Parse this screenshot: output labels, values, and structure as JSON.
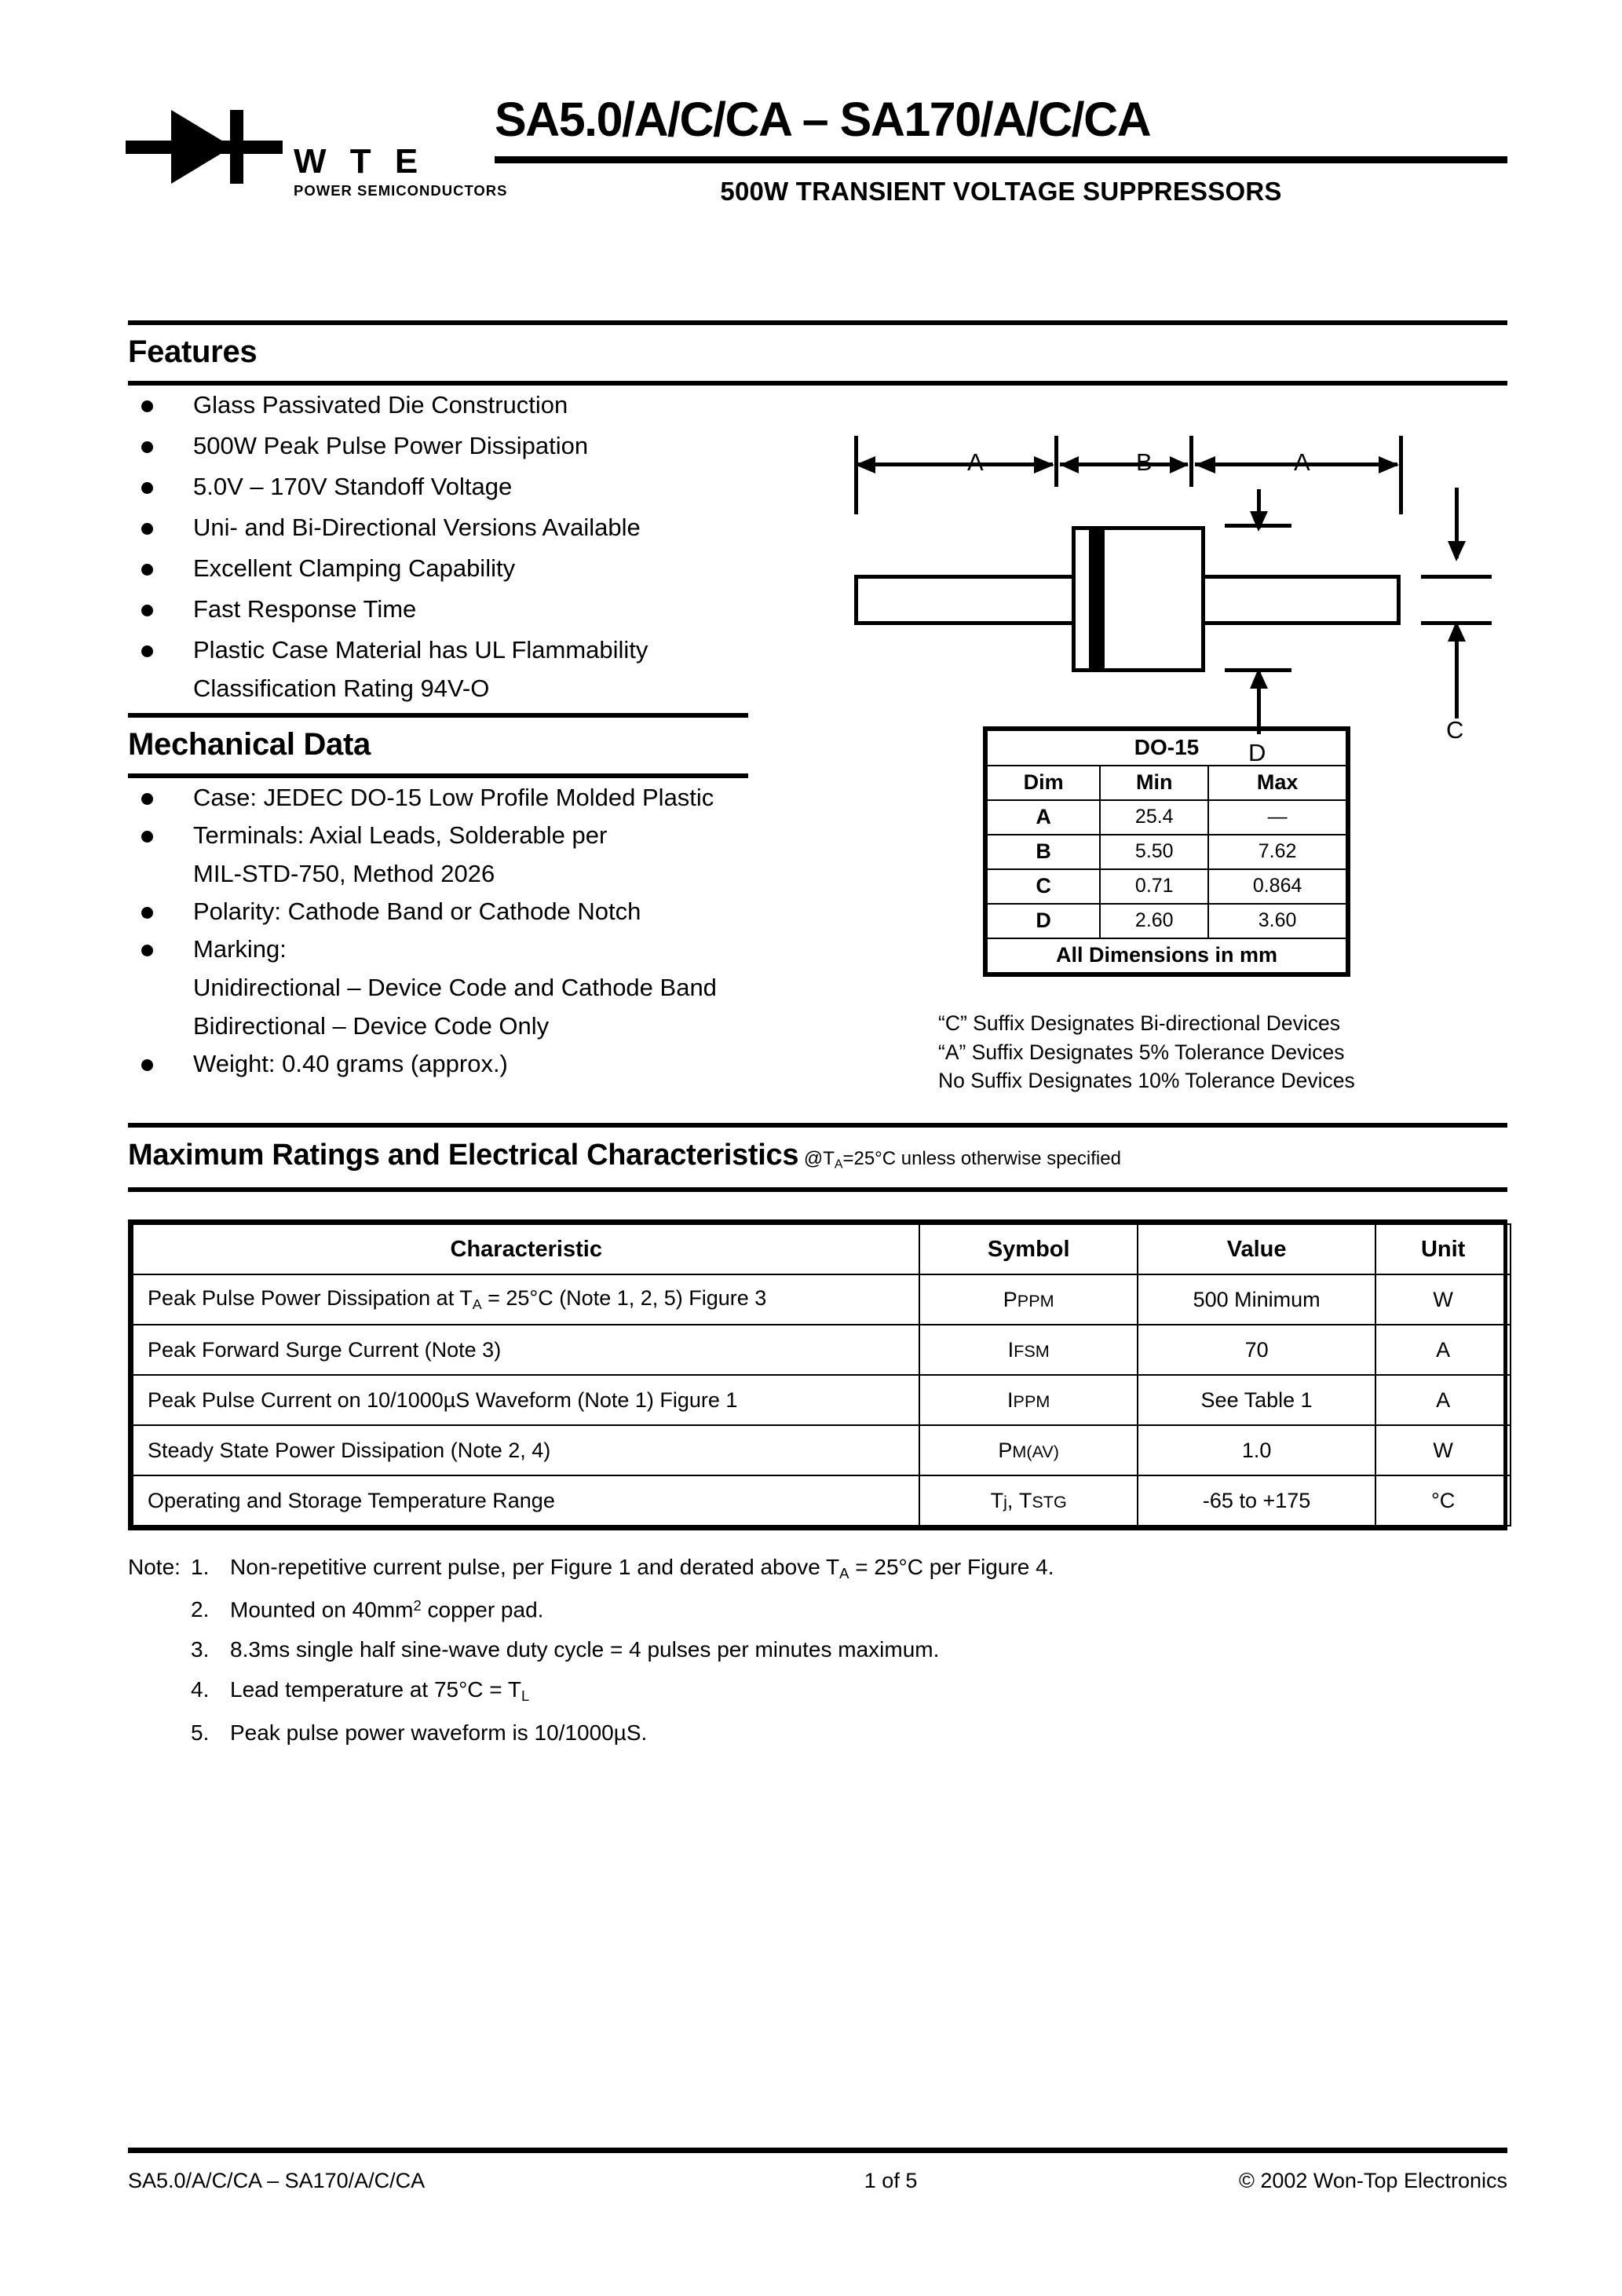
{
  "header": {
    "logo": {
      "brand": "W T E",
      "tagline": "POWER SEMICONDUCTORS"
    },
    "title": "SA5.0/A/C/CA – SA170/A/C/CA",
    "subtitle": "500W TRANSIENT VOLTAGE SUPPRESSORS"
  },
  "features": {
    "heading": "Features",
    "items": [
      "Glass Passivated Die Construction",
      "500W Peak Pulse Power Dissipation",
      "5.0V – 170V Standoff Voltage",
      "Uni- and Bi-Directional Versions Available",
      "Excellent Clamping Capability",
      "Fast Response Time",
      "Plastic Case Material has UL Flammability"
    ],
    "item7_cont": "Classification Rating 94V-O"
  },
  "mechanical": {
    "heading": "Mechanical Data",
    "items": [
      "Case: JEDEC DO-15 Low Profile Molded Plastic",
      "Terminals: Axial Leads, Solderable per",
      "Polarity: Cathode Band or Cathode Notch",
      "Marking:",
      "Weight: 0.40 grams (approx.)"
    ],
    "item2_cont": "MIL-STD-750, Method 2026",
    "marking_line1": "Unidirectional – Device Code and Cathode Band",
    "marking_line2": "Bidirectional – Device Code Only"
  },
  "package_drawing": {
    "label_a_left": "A",
    "label_b": "B",
    "label_a_right": "A",
    "label_c": "C",
    "label_d": "D"
  },
  "dim_table": {
    "title": "DO-15",
    "headers": [
      "Dim",
      "Min",
      "Max"
    ],
    "rows": [
      [
        "A",
        "25.4",
        "—"
      ],
      [
        "B",
        "5.50",
        "7.62"
      ],
      [
        "C",
        "0.71",
        "0.864"
      ],
      [
        "D",
        "2.60",
        "3.60"
      ]
    ],
    "footer": "All Dimensions in mm"
  },
  "suffix_notes": [
    "“C” Suffix Designates Bi-directional Devices",
    "“A” Suffix Designates 5% Tolerance Devices",
    "No Suffix Designates 10% Tolerance Devices"
  ],
  "max_ratings": {
    "heading": "Maximum Ratings and Electrical Characteristics",
    "heading_suffix_pre": "@T",
    "heading_suffix_sub": "A",
    "heading_suffix_post": "=25°C unless otherwise specified",
    "columns": [
      "Characteristic",
      "Symbol",
      "Value",
      "Unit"
    ],
    "rows": [
      {
        "characteristic_pre": "Peak Pulse Power Dissipation at T",
        "characteristic_sub": "A",
        "characteristic_post": " = 25°C (Note 1, 2, 5) Figure 3",
        "symbol_main": "P",
        "symbol_sub": "PPM",
        "value": "500 Minimum",
        "unit": "W"
      },
      {
        "characteristic_pre": "Peak Forward Surge Current (Note 3)",
        "characteristic_sub": "",
        "characteristic_post": "",
        "symbol_main": "I",
        "symbol_sub": "FSM",
        "value": "70",
        "unit": "A"
      },
      {
        "characteristic_pre": "Peak Pulse Current on 10/1000µS Waveform (Note 1) Figure 1",
        "characteristic_sub": "",
        "characteristic_post": "",
        "symbol_main": "I",
        "symbol_sub": "PPM",
        "value": "See Table 1",
        "unit": "A"
      },
      {
        "characteristic_pre": "Steady State Power Dissipation (Note 2, 4)",
        "characteristic_sub": "",
        "characteristic_post": "",
        "symbol_main": "P",
        "symbol_sub": "M(AV)",
        "value": "1.0",
        "unit": "W"
      },
      {
        "characteristic_pre": "Operating and Storage Temperature Range",
        "characteristic_sub": "",
        "characteristic_post": "",
        "symbol_main": "T",
        "symbol_sub": "j",
        "symbol_main2": "T",
        "symbol_sub2": "STG",
        "value": "-65 to +175",
        "unit": "°C"
      }
    ]
  },
  "notes": {
    "label": "Note:",
    "items": [
      {
        "num": "1.",
        "pre": "Non-repetitive current pulse, per Figure 1 and derated above T",
        "sub": "A",
        "post": " = 25°C per Figure 4."
      },
      {
        "num": "2.",
        "pre": "Mounted on 40mm",
        "sup": "2",
        "post": " copper pad."
      },
      {
        "num": "3.",
        "pre": "8.3ms single half sine-wave duty cycle = 4 pulses per minutes maximum.",
        "post": ""
      },
      {
        "num": "4.",
        "pre": "Lead temperature at 75°C = T",
        "sub": "L",
        "post": ""
      },
      {
        "num": "5.",
        "pre": "Peak pulse power waveform is 10/1000µS.",
        "post": ""
      }
    ]
  },
  "footer": {
    "left": "SA5.0/A/C/CA – SA170/A/C/CA",
    "center": "1  of  5",
    "right": "© 2002 Won-Top Electronics"
  }
}
